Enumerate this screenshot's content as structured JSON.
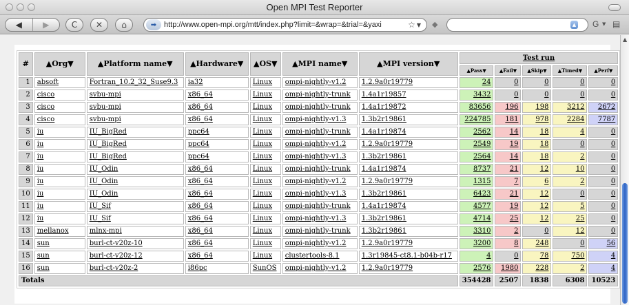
{
  "window": {
    "title": "Open MPI Test Reporter",
    "traffic_colors": [
      "#d9d9d9",
      "#d9d9d9",
      "#d9d9d9"
    ]
  },
  "toolbar": {
    "back_glyph": "◀",
    "forward_glyph": "▶",
    "reload_glyph": "C",
    "stop_glyph": "✕",
    "home_glyph": "⌂",
    "url": "http://www.open-mpi.org/mtt/index.php?limit=&wrap=&trial=&yaxi",
    "url_icon_glyph": "➡",
    "star_glyph": "☆",
    "dropdown_glyph": "▼",
    "search_engine_glyph": "G",
    "search_placeholder": ""
  },
  "table": {
    "headers": {
      "index": "#",
      "org": "▲Org▼",
      "platform": "▲Platform name▼",
      "hardware": "▲Hardware▼",
      "os": "▲OS▼",
      "mpi_name": "▲MPI name▼",
      "mpi_version": "▲MPI version▼",
      "test_run": "Test run",
      "pass": "▲Pass▼",
      "fail": "▲Fail▼",
      "skip": "▲Skip▼",
      "timed": "▲Timed▼",
      "perf": "▲Perf▼"
    },
    "rows": [
      {
        "n": "1",
        "org": "absoft",
        "platform": "Fortran_10.2_32_Suse9.3",
        "hardware": "ia32",
        "os": "Linux",
        "mpi_name": "ompi-nightly-v1.2",
        "mpi_version": "1.2.9a0r19779",
        "pass": "24",
        "fail": "0",
        "skip": "0",
        "timed": "0",
        "perf": "0"
      },
      {
        "n": "2",
        "org": "cisco",
        "platform": "svbu-mpi",
        "hardware": "x86_64",
        "os": "Linux",
        "mpi_name": "ompi-nightly-trunk",
        "mpi_version": "1.4a1r19857",
        "pass": "3432",
        "fail": "0",
        "skip": "0",
        "timed": "0",
        "perf": "0"
      },
      {
        "n": "3",
        "org": "cisco",
        "platform": "svbu-mpi",
        "hardware": "x86_64",
        "os": "Linux",
        "mpi_name": "ompi-nightly-trunk",
        "mpi_version": "1.4a1r19872",
        "pass": "83656",
        "fail": "196",
        "skip": "198",
        "timed": "3212",
        "perf": "2672"
      },
      {
        "n": "4",
        "org": "cisco",
        "platform": "svbu-mpi",
        "hardware": "x86_64",
        "os": "Linux",
        "mpi_name": "ompi-nightly-v1.3",
        "mpi_version": "1.3b2r19861",
        "pass": "224785",
        "fail": "181",
        "skip": "978",
        "timed": "2284",
        "perf": "7787"
      },
      {
        "n": "5",
        "org": "iu",
        "platform": "IU_BigRed",
        "hardware": "ppc64",
        "os": "Linux",
        "mpi_name": "ompi-nightly-trunk",
        "mpi_version": "1.4a1r19874",
        "pass": "2562",
        "fail": "14",
        "skip": "18",
        "timed": "4",
        "perf": "0"
      },
      {
        "n": "6",
        "org": "iu",
        "platform": "IU_BigRed",
        "hardware": "ppc64",
        "os": "Linux",
        "mpi_name": "ompi-nightly-v1.2",
        "mpi_version": "1.2.9a0r19779",
        "pass": "2549",
        "fail": "19",
        "skip": "18",
        "timed": "0",
        "perf": "0"
      },
      {
        "n": "7",
        "org": "iu",
        "platform": "IU_BigRed",
        "hardware": "ppc64",
        "os": "Linux",
        "mpi_name": "ompi-nightly-v1.3",
        "mpi_version": "1.3b2r19861",
        "pass": "2564",
        "fail": "14",
        "skip": "18",
        "timed": "2",
        "perf": "0"
      },
      {
        "n": "8",
        "org": "iu",
        "platform": "IU_Odin",
        "hardware": "x86_64",
        "os": "Linux",
        "mpi_name": "ompi-nightly-trunk",
        "mpi_version": "1.4a1r19874",
        "pass": "8737",
        "fail": "21",
        "skip": "12",
        "timed": "10",
        "perf": "0"
      },
      {
        "n": "9",
        "org": "iu",
        "platform": "IU_Odin",
        "hardware": "x86_64",
        "os": "Linux",
        "mpi_name": "ompi-nightly-v1.2",
        "mpi_version": "1.2.9a0r19779",
        "pass": "1315",
        "fail": "7",
        "skip": "6",
        "timed": "2",
        "perf": "0"
      },
      {
        "n": "10",
        "org": "iu",
        "platform": "IU_Odin",
        "hardware": "x86_64",
        "os": "Linux",
        "mpi_name": "ompi-nightly-v1.3",
        "mpi_version": "1.3b2r19861",
        "pass": "6423",
        "fail": "21",
        "skip": "12",
        "timed": "0",
        "perf": "0"
      },
      {
        "n": "11",
        "org": "iu",
        "platform": "IU_Sif",
        "hardware": "x86_64",
        "os": "Linux",
        "mpi_name": "ompi-nightly-trunk",
        "mpi_version": "1.4a1r19874",
        "pass": "4577",
        "fail": "19",
        "skip": "12",
        "timed": "5",
        "perf": "0"
      },
      {
        "n": "12",
        "org": "iu",
        "platform": "IU_Sif",
        "hardware": "x86_64",
        "os": "Linux",
        "mpi_name": "ompi-nightly-v1.3",
        "mpi_version": "1.3b2r19861",
        "pass": "4714",
        "fail": "25",
        "skip": "12",
        "timed": "25",
        "perf": "0"
      },
      {
        "n": "13",
        "org": "mellanox",
        "platform": "mlnx-mpi",
        "hardware": "x86_64",
        "os": "Linux",
        "mpi_name": "ompi-nightly-trunk",
        "mpi_version": "1.3b2r19861",
        "pass": "3310",
        "fail": "2",
        "skip": "0",
        "timed": "12",
        "perf": "0"
      },
      {
        "n": "14",
        "org": "sun",
        "platform": "burl-ct-v20z-10",
        "hardware": "x86_64",
        "os": "Linux",
        "mpi_name": "ompi-nightly-v1.2",
        "mpi_version": "1.2.9a0r19779",
        "pass": "3200",
        "fail": "8",
        "skip": "248",
        "timed": "0",
        "perf": "56"
      },
      {
        "n": "15",
        "org": "sun",
        "platform": "burl-ct-v20z-12",
        "hardware": "x86_64",
        "os": "Linux",
        "mpi_name": "clustertools-8.1",
        "mpi_version": "1.3r19845-ct8.1-b04b-r17",
        "pass": "4",
        "fail": "0",
        "skip": "78",
        "timed": "750",
        "perf": "4"
      },
      {
        "n": "16",
        "org": "sun",
        "platform": "burl-ct-v20z-2",
        "hardware": "i86pc",
        "os": "SunOS",
        "mpi_name": "ompi-nightly-v1.2",
        "mpi_version": "1.2.9a0r19779",
        "pass": "2576",
        "fail": "1980",
        "skip": "228",
        "timed": "2",
        "perf": "4"
      }
    ],
    "totals": {
      "label": "Totals",
      "pass": "354428",
      "fail": "2507",
      "skip": "1838",
      "timed": "6308",
      "perf": "10523"
    }
  },
  "colors": {
    "pass": "#cdf2b8",
    "fail": "#f7c8c8",
    "skip_timed": "#f9f5c0",
    "perf": "#cfd2f7",
    "neutral": "#d6d6d6"
  }
}
